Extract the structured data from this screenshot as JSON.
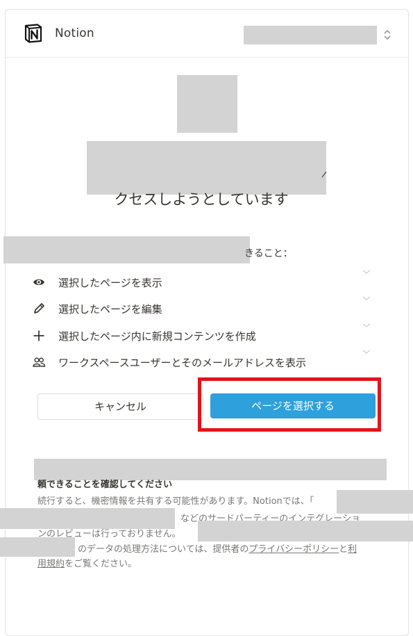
{
  "header": {
    "brand": "Notion",
    "icon": "notion-logo-icon"
  },
  "request": {
    "title_line2": "クセスしようとしています",
    "capabilities_suffix": "きること："
  },
  "permissions": [
    {
      "icon": "eye-icon",
      "label": "選択したページを表示"
    },
    {
      "icon": "pencil-icon",
      "label": "選択したページを編集"
    },
    {
      "icon": "plus-icon",
      "label": "選択したページ内に新規コンテンツを作成"
    },
    {
      "icon": "users-icon",
      "label": "ワークスペースユーザーとそのメールアドレスを表示"
    }
  ],
  "actions": {
    "cancel": "キャンセル",
    "select": "ページを選択する"
  },
  "notice": {
    "title": "頼できることを確認してください",
    "line1": "続行すると、機密情報を共有する可能性があります。Notionでは、「",
    "line2": "などのサードパーティーのインテグレーショ",
    "line3": "ンのレビューは行っておりません。",
    "line4_pre": "のデータの処理方法については、提供者の",
    "privacy_link": "プライバシーポリシー",
    "and": "と",
    "terms_link_a": "利",
    "terms_link_b": "用規約",
    "line5_post": "をご覧ください。"
  },
  "colors": {
    "accent": "#2ea0dc",
    "highlight": "#e3131b",
    "redaction": "#d3d3d3"
  }
}
